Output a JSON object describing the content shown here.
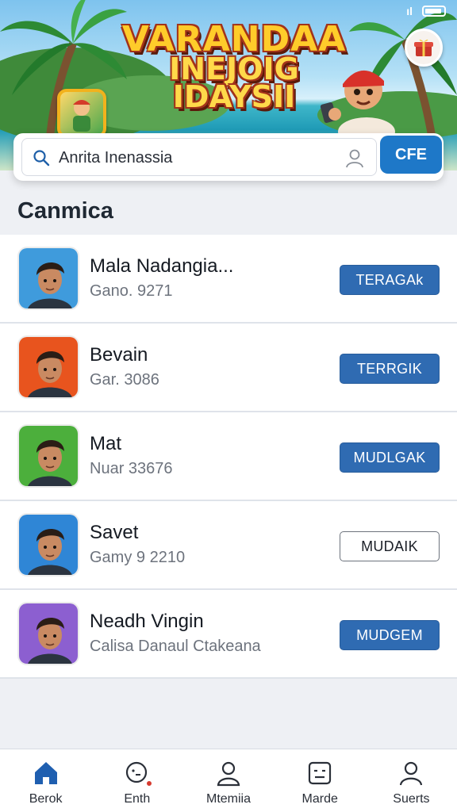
{
  "status_bar": {
    "signal_text": "ıl"
  },
  "banner": {
    "title_line1": "VARANDAA",
    "title_line2": "INEJOIG IDAYSII"
  },
  "search": {
    "value": "Anrita Inenassia",
    "placeholder": "Anrita Inenassia",
    "button_label": "CFE"
  },
  "section": {
    "title": "Canmica"
  },
  "list": [
    {
      "name": "Mala Nadangia...",
      "sub": "Gano. 9271",
      "action": "TERAGAk",
      "action_style": "filled",
      "avatar_bg": "#3f9bdc"
    },
    {
      "name": "Bevain",
      "sub": "Gar. 3086",
      "action": "TERRGIK",
      "action_style": "filled",
      "avatar_bg": "#e8541e"
    },
    {
      "name": "Mat",
      "sub": "Nuar 33676",
      "action": "MUDLGAK",
      "action_style": "filled",
      "avatar_bg": "#4caf3c"
    },
    {
      "name": "Savet",
      "sub": "Gamy 9 2210",
      "action": "MUDAIK",
      "action_style": "outline",
      "avatar_bg": "#2f86d6"
    },
    {
      "name": "Neadh Vingin",
      "sub": "Calisa Danaul Ctakeana",
      "action": "MUDGEM",
      "action_style": "filled",
      "avatar_bg": "#8c5fd0"
    }
  ],
  "nav": [
    {
      "label": "Berok",
      "icon": "home-icon",
      "active": true
    },
    {
      "label": "Enth",
      "icon": "chat-icon",
      "active": false
    },
    {
      "label": "Mtemiia",
      "icon": "profile-icon",
      "active": false
    },
    {
      "label": "Marde",
      "icon": "face-box-icon",
      "active": false
    },
    {
      "label": "Suerts",
      "icon": "user-icon",
      "active": false
    }
  ],
  "colors": {
    "accent": "#1e78c8",
    "action_button": "#2f6bb2",
    "nav_active": "#1f5fb0"
  }
}
